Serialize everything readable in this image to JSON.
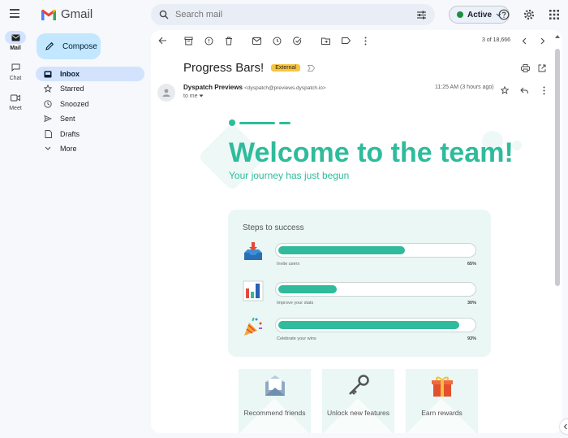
{
  "app": {
    "name": "Gmail"
  },
  "search": {
    "placeholder": "Search mail"
  },
  "status": {
    "label": "Active",
    "color": "#1e8e3e"
  },
  "rail": [
    {
      "label": "Mail",
      "icon": "mail-icon",
      "active": true
    },
    {
      "label": "Chat",
      "icon": "chat-icon",
      "active": false
    },
    {
      "label": "Meet",
      "icon": "meet-icon",
      "active": false
    }
  ],
  "compose": {
    "label": "Compose"
  },
  "nav": [
    {
      "label": "Inbox",
      "icon": "inbox-icon",
      "active": true
    },
    {
      "label": "Starred",
      "icon": "star-icon",
      "active": false
    },
    {
      "label": "Snoozed",
      "icon": "clock-icon",
      "active": false
    },
    {
      "label": "Sent",
      "icon": "send-icon",
      "active": false
    },
    {
      "label": "Drafts",
      "icon": "draft-icon",
      "active": false
    },
    {
      "label": "More",
      "icon": "chevron-down-icon",
      "active": false
    }
  ],
  "toolbar": {
    "pager": "3 of 18,666"
  },
  "email": {
    "subject": "Progress Bars!",
    "badge": "External",
    "sender_name": "Dyspatch Previews",
    "sender_email": "<dyspatch@previews.dyspatch.io>",
    "to": "to me",
    "time": "11:25 AM (3 hours ago)"
  },
  "content": {
    "headline": "Welcome to the team!",
    "tagline": "Your journey has just begun",
    "steps_title": "Steps to success",
    "steps": [
      {
        "label": "Invite users",
        "percent": 65,
        "percent_label": "65%",
        "icon": "inbox-download-icon"
      },
      {
        "label": "Improve your stats",
        "percent": 30,
        "percent_label": "30%",
        "icon": "bar-chart-icon"
      },
      {
        "label": "Celebrate your wins",
        "percent": 93,
        "percent_label": "93%",
        "icon": "party-popper-icon"
      }
    ],
    "features": [
      {
        "label": "Recommend friends",
        "icon": "envelope-icon"
      },
      {
        "label": "Unlock new features",
        "icon": "key-icon"
      },
      {
        "label": "Earn rewards",
        "icon": "gift-icon"
      }
    ],
    "accent": "#2fbb9c"
  }
}
